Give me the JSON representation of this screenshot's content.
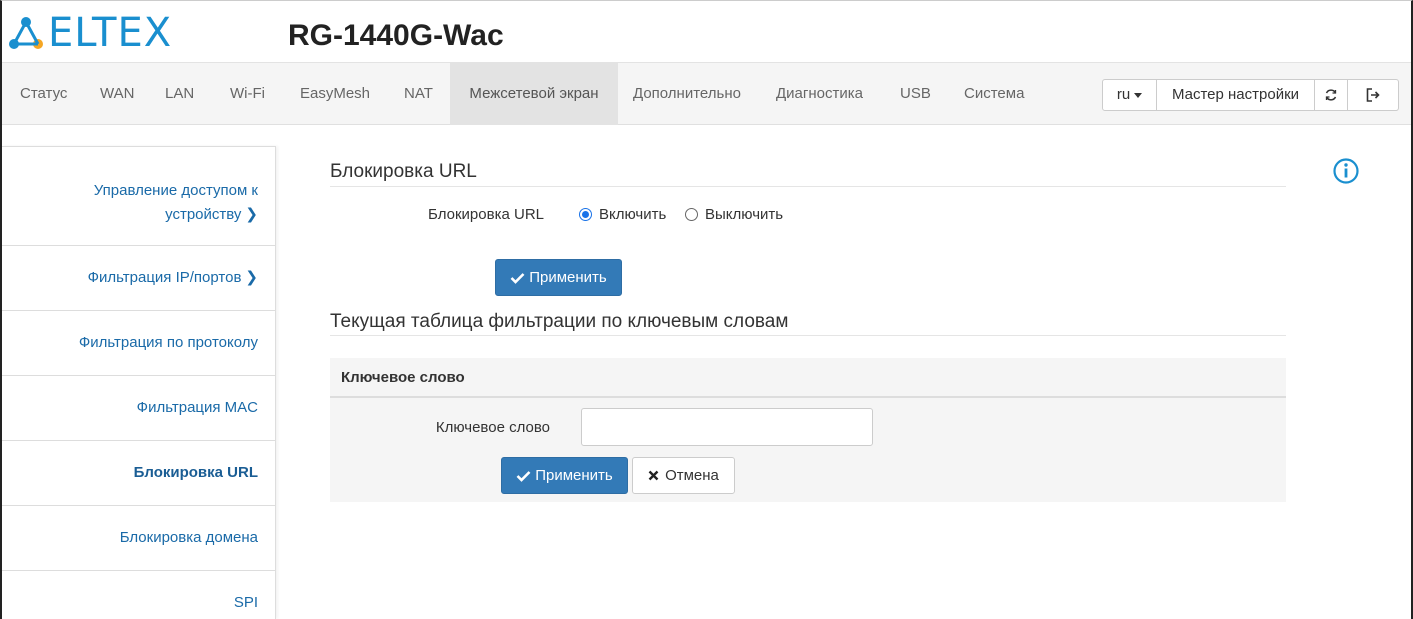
{
  "brand": {
    "logo_text": "ELTEX",
    "device": "RG-1440G-Wac",
    "color": "#1a8fcf"
  },
  "nav": {
    "items": [
      "Статус",
      "WAN",
      "LAN",
      "Wi-Fi",
      "EasyMesh",
      "NAT",
      "Межсетевой экран",
      "Дополнительно",
      "Диагностика",
      "USB",
      "Система"
    ],
    "active": "Межсетевой экран",
    "lang": "ru",
    "wizard": "Мастер настройки",
    "refresh_icon": "refresh-icon",
    "logout_icon": "logout-icon"
  },
  "sidebar": {
    "items": [
      {
        "label_line1": "Управление доступом к",
        "label_line2": "устройству",
        "chevron": "❯"
      },
      {
        "label": "Фильтрация IP/портов",
        "chevron": "❯"
      },
      {
        "label": "Фильтрация по протоколу"
      },
      {
        "label": "Фильтрация MAC"
      },
      {
        "label": "Блокировка URL"
      },
      {
        "label": "Блокировка домена"
      },
      {
        "label": "SPI"
      }
    ]
  },
  "url_block": {
    "title": "Блокировка URL",
    "field_label": "Блокировка URL",
    "options": [
      "Включить",
      "Выключить"
    ],
    "selected": "Включить",
    "apply": "Применить"
  },
  "keyword_table": {
    "title": "Текущая таблица фильтрации по ключевым словам",
    "column": "Ключевое слово",
    "input_label": "Ключевое слово",
    "input_value": "",
    "apply": "Применить",
    "cancel": "Отмена"
  },
  "colors": {
    "primary": "#337ab7",
    "link": "#1a6aa8",
    "info": "#1a8fcf"
  }
}
